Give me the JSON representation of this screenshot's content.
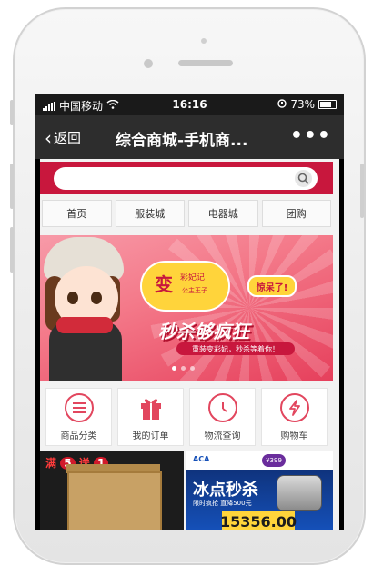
{
  "status_bar": {
    "carrier": "中国移动",
    "time": "16:16",
    "battery": "73%"
  },
  "nav": {
    "back_label": "返回",
    "title": "综合商城-手机商...",
    "more": "•••"
  },
  "tabs": [
    "首页",
    "服装城",
    "电器城",
    "团购"
  ],
  "banner": {
    "bubble_main": "变",
    "bubble_sub": "彩妃记",
    "bubble_sub2": "公主王子",
    "tag": "惊呆了!",
    "slogan": "秒杀够疯狂",
    "ribbon": "重装变彩妃，秒杀等着你！"
  },
  "categories": [
    {
      "label": "商品分类",
      "icon": "list-icon"
    },
    {
      "label": "我的订单",
      "icon": "gift-icon"
    },
    {
      "label": "物流查询",
      "icon": "clock-icon"
    },
    {
      "label": "购物车",
      "icon": "lightning-icon"
    }
  ],
  "promo_left": {
    "badge_pre": "满",
    "badge_num": "5",
    "badge_mid": "送",
    "badge_num2": "1"
  },
  "promo_right": {
    "logo": "ACA",
    "price": "¥399",
    "title": "冰点秒杀",
    "sub": "限时疯抢  直降500元",
    "bottom": "15356.00"
  },
  "colors": {
    "accent": "#c8173d",
    "icon": "#e2465e",
    "navbar": "#2d2d2d"
  }
}
